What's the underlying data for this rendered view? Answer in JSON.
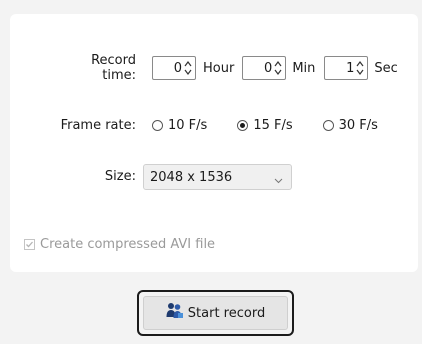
{
  "record_time": {
    "label": "Record time:",
    "hour": {
      "value": "0",
      "unit": "Hour"
    },
    "min": {
      "value": "0",
      "unit": "Min"
    },
    "sec": {
      "value": "1",
      "unit": "Sec"
    }
  },
  "frame_rate": {
    "label": "Frame rate:",
    "options": [
      {
        "label": "10 F/s",
        "selected": false
      },
      {
        "label": "15 F/s",
        "selected": true
      },
      {
        "label": "30 F/s",
        "selected": false
      }
    ]
  },
  "size": {
    "label": "Size:",
    "selected": "2048 x 1536"
  },
  "compress": {
    "label": "Create compressed AVI file",
    "checked": true,
    "enabled": false
  },
  "start_button": {
    "label": "Start record",
    "icon": "users-icon"
  },
  "colors": {
    "panel": "#ffffff",
    "background": "#f3f3f3",
    "disabled_text": "#9a9a9a"
  }
}
